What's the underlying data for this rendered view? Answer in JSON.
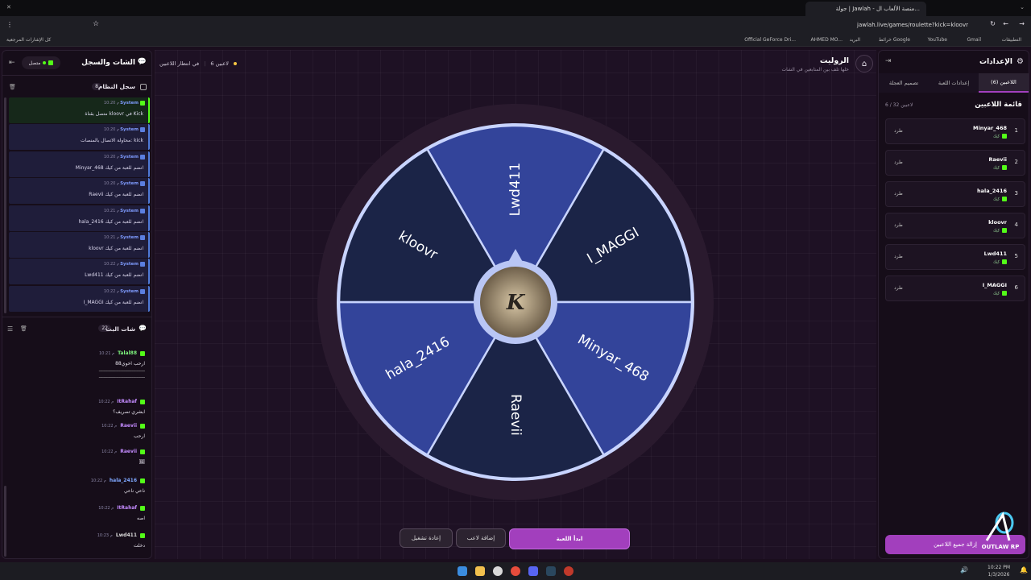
{
  "browser": {
    "tab_title": "جولة | Jawlah - منصة الألعاب ال...",
    "url": "jawlah.live/games/roulette?kick=kloovr",
    "bookmarks": [
      "التطبيقات",
      "Gmail",
      "YouTube",
      "خرائط Google",
      "البريد",
      "AHMED MO...",
      "Official GeForce Dri...",
      "كل الإشارات المرجعية"
    ]
  },
  "left_panel": {
    "title": "الشات والسجل",
    "status": "متصل",
    "system_log": {
      "title": "سجل النظام",
      "count": "8",
      "entries": [
        {
          "who": "System",
          "time": "10:20 م",
          "text": "متصل بقناة kloovr في Kick"
        },
        {
          "who": "System",
          "time": "10:20 م",
          "text": "محاولة الاتصال بالمنصات: kick"
        },
        {
          "who": "System",
          "time": "10:20 م",
          "text": "Minyar_468 انضم للعبة من كيك"
        },
        {
          "who": "System",
          "time": "10:20 م",
          "text": "Raevii انضم للعبة من كيك"
        },
        {
          "who": "System",
          "time": "10:21 م",
          "text": "hala_2416 انضم للعبة من كيك"
        },
        {
          "who": "System",
          "time": "10:21 م",
          "text": "kloovr انضم للعبة من كيك"
        },
        {
          "who": "System",
          "time": "10:22 م",
          "text": "Lwd411 انضم للعبة من كيك"
        },
        {
          "who": "System",
          "time": "10:22 م",
          "text": "I_MAGGI انضم للعبة من كيك"
        }
      ]
    },
    "live_chat": {
      "title": "شات البث",
      "count": "22",
      "messages": [
        {
          "name": "Talal88",
          "time": "10:21 م",
          "color": "#7cf07c",
          "lines": [
            "ارحب اخوي88",
            "ـــــــــــــــــــــــــــــــــــــــ",
            "ـــــــــــــــــــــــــــــــــــــــ"
          ]
        },
        {
          "name": "ItRahaf",
          "time": "10:22 م",
          "color": "#c48bff",
          "lines": [
            "ابشري تصريف؟"
          ]
        },
        {
          "name": "Raevii",
          "time": "10:22 م",
          "color": "#c48bff",
          "lines": [
            "ارحب"
          ]
        },
        {
          "name": "Raevii",
          "time": "10:22 م",
          "color": "#c48bff",
          "lines": [
            "🖼"
          ]
        },
        {
          "name": "hala_2416",
          "time": "10:22 م",
          "color": "#7fa8ff",
          "lines": [
            "ناعي ناعي"
          ]
        },
        {
          "name": "ItRahaf",
          "time": "10:22 م",
          "color": "#c48bff",
          "lines": [
            "اصه"
          ]
        },
        {
          "name": "Lwd411",
          "time": "10:23 م",
          "color": "#dddddd",
          "lines": [
            "دخلت"
          ]
        }
      ]
    }
  },
  "center": {
    "title": "الروليت",
    "subtitle": "خلها تلف بين المتابعين في الشات",
    "waiting_label": "في انتظار اللاعبين",
    "players_count": "6 لاعبين",
    "logo_letter": "K",
    "buttons": {
      "start": "ابدأ اللعبة",
      "add_player": "إضافة لاعب",
      "restart": "إعادة تشغيل"
    },
    "wheel_segments": [
      {
        "name": "Lwd411",
        "color": "#33449a"
      },
      {
        "name": "I_MAGGI",
        "color": "#1b2447"
      },
      {
        "name": "Minyar_468",
        "color": "#33449a"
      },
      {
        "name": "Raevii",
        "color": "#1b2447"
      },
      {
        "name": "hala_2416",
        "color": "#33449a"
      },
      {
        "name": "kloovr",
        "color": "#1b2447"
      }
    ]
  },
  "right_panel": {
    "title": "الإعدادات",
    "tabs": [
      "اللاعبين (6)",
      "إعدادات اللعبة",
      "تصميم العجلة"
    ],
    "list_title": "قائمة اللاعبين",
    "list_count": "6 / 32 لاعبين",
    "kick_label": "طرد",
    "platform_label": "كيك",
    "players": [
      {
        "num": "1",
        "name": "Minyar_468"
      },
      {
        "num": "2",
        "name": "Raevii"
      },
      {
        "num": "3",
        "name": "hala_2416"
      },
      {
        "num": "4",
        "name": "kloovr"
      },
      {
        "num": "5",
        "name": "Lwd411"
      },
      {
        "num": "6",
        "name": "I_MAGGI"
      }
    ],
    "remove_all": "إزالة جميع اللاعبين"
  },
  "watermark": "OUTLAW RP",
  "taskbar": {
    "time": "10:22 PM",
    "date": "1/3/2026"
  }
}
